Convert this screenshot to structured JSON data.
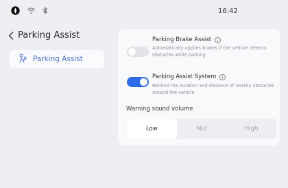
{
  "status_bar": {
    "time": "16:42",
    "icons": [
      "app-logo-icon",
      "wifi-icon",
      "bluetooth-icon"
    ]
  },
  "header": {
    "back_icon": "chevron-left-icon",
    "title": "Parking Assist"
  },
  "sidebar": {
    "items": [
      {
        "label": "Parking Assist",
        "icon": "parking-assist-icon",
        "selected": true
      }
    ]
  },
  "settings": {
    "parking_brake_assist": {
      "title": "Parking Brake Assist",
      "description": "Automatically applies brakes if the vehicle detects obstacles while parking",
      "enabled": false
    },
    "parking_assist_system": {
      "title": "Parking Assist System",
      "description": "Remind the location and distance of nearby obstacles around the vehicle",
      "enabled": true
    }
  },
  "warning_volume": {
    "label": "Warning sound volume",
    "options": [
      "Low",
      "Mid",
      "High"
    ],
    "selected": "Low"
  },
  "colors": {
    "accent": "#2f6de8",
    "sidebar_label": "#4a6fcf",
    "background": "#eeeff2"
  }
}
